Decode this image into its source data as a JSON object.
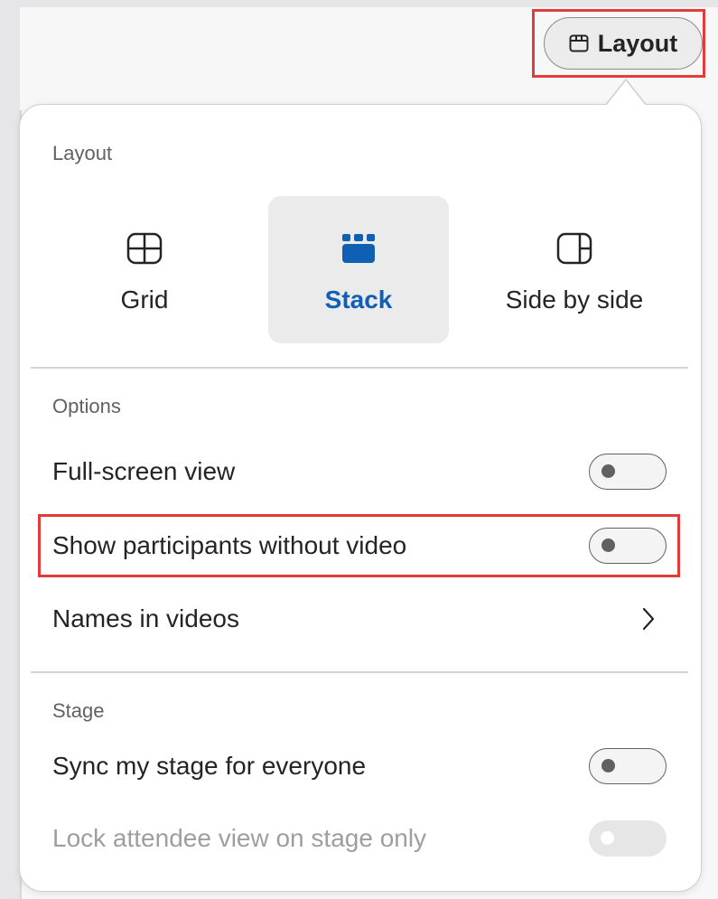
{
  "toolbar": {
    "layout_button_label": "Layout"
  },
  "panel": {
    "layout_section": {
      "title": "Layout",
      "options": [
        {
          "label": "Grid",
          "icon": "grid-icon",
          "selected": false
        },
        {
          "label": "Stack",
          "icon": "stack-icon",
          "selected": true
        },
        {
          "label": "Side by side",
          "icon": "side-by-side-icon",
          "selected": false
        }
      ]
    },
    "options_section": {
      "title": "Options",
      "full_screen_label": "Full-screen view",
      "full_screen_on": false,
      "show_participants_label": "Show participants without video",
      "show_participants_on": false,
      "names_in_videos_label": "Names in videos"
    },
    "stage_section": {
      "title": "Stage",
      "sync_stage_label": "Sync my stage for everyone",
      "sync_stage_on": false,
      "lock_attendee_label": "Lock attendee view on stage only",
      "lock_attendee_on": false,
      "lock_attendee_disabled": true
    }
  },
  "colors": {
    "accent": "#0f5fb5",
    "highlight": "#e23b3b",
    "selected_tile_bg": "#ebebeb"
  }
}
